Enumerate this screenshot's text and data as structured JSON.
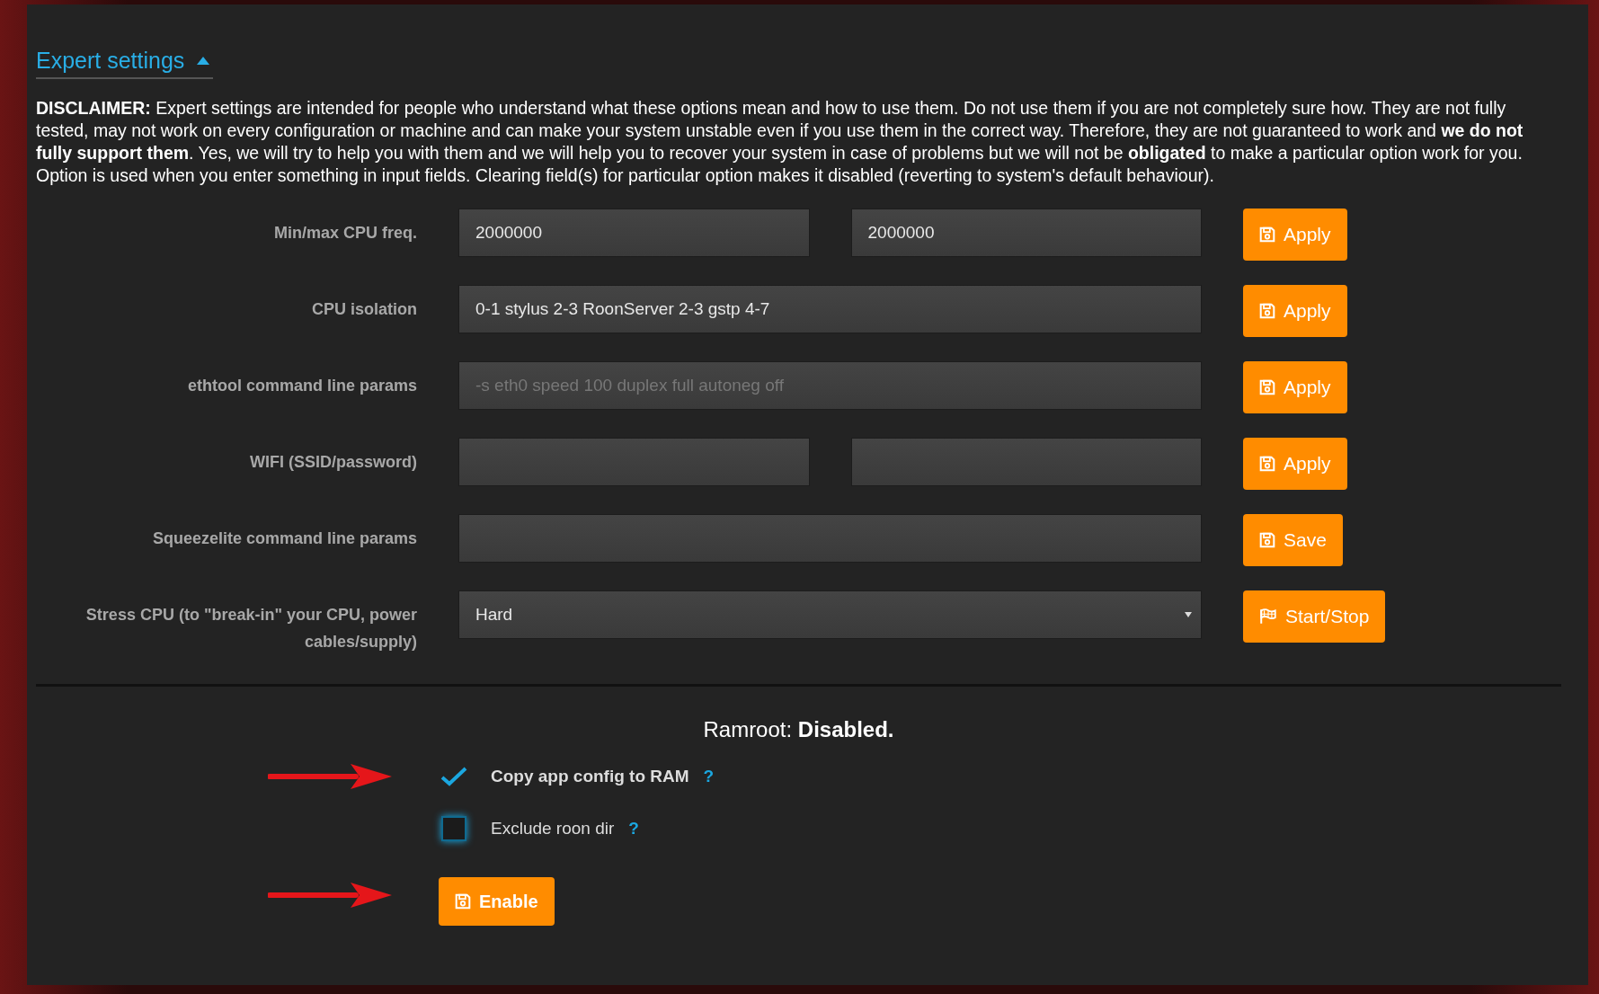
{
  "section": {
    "title": "Expert settings",
    "expanded": true
  },
  "disclaimer": [
    "**DISCLAIMER:** Expert settings are intended for people who understand what these options mean and how to use them. Do not use them if you are not completely sure how. They are not fully tested, may not work on every configuration or machine and can make your system unstable even if you use them in the correct way. Therefore, they are not guaranteed to work and **we do not fully support them**. Yes, we will try to help you with them and we will help you to recover your system in case of problems but we will not be **obligated** to make a particular option work for you.",
    "Option is used when you enter something in input fields. Clearing field(s) for particular option makes it disabled (reverting to system's default behaviour)."
  ],
  "settings": [
    {
      "label": "Min/max CPU freq.",
      "kind": "pair",
      "fields": [
        {
          "value": "2000000"
        },
        {
          "value": "2000000"
        }
      ],
      "button": {
        "label": "Apply",
        "kind": "save"
      }
    },
    {
      "label": "CPU isolation",
      "kind": "single",
      "fields": [
        {
          "value": "0-1 stylus 2-3 RoonServer 2-3 gstp 4-7"
        }
      ],
      "button": {
        "label": "Apply",
        "kind": "save"
      }
    },
    {
      "label": "ethtool command line params",
      "kind": "single",
      "fields": [
        {
          "placeholder": "-s eth0 speed 100 duplex full autoneg off"
        }
      ],
      "button": {
        "label": "Apply",
        "kind": "save"
      }
    },
    {
      "label": "WIFI (SSID/password)",
      "kind": "pair",
      "button": {
        "label": "Apply",
        "kind": "save"
      }
    },
    {
      "label": "Squeezelite command line params",
      "kind": "single",
      "button": {
        "label": "Save",
        "kind": "save"
      }
    },
    {
      "label": "Stress CPU (to \"break-in\" your CPU, power cables/supply)",
      "kind": "select",
      "fields": [
        {
          "value": "Hard"
        }
      ],
      "button": {
        "label": "Start/Stop",
        "kind": "flag"
      }
    }
  ],
  "ramroot": {
    "label": "Ramroot:",
    "status": "Disabled."
  },
  "options": [
    {
      "label": "Copy app config to RAM",
      "help": "?",
      "checked": true,
      "marked": true
    },
    {
      "label": "Exclude roon dir",
      "help": "?",
      "checked": false
    }
  ],
  "enable_button": {
    "label": "Enable",
    "marked": true
  }
}
